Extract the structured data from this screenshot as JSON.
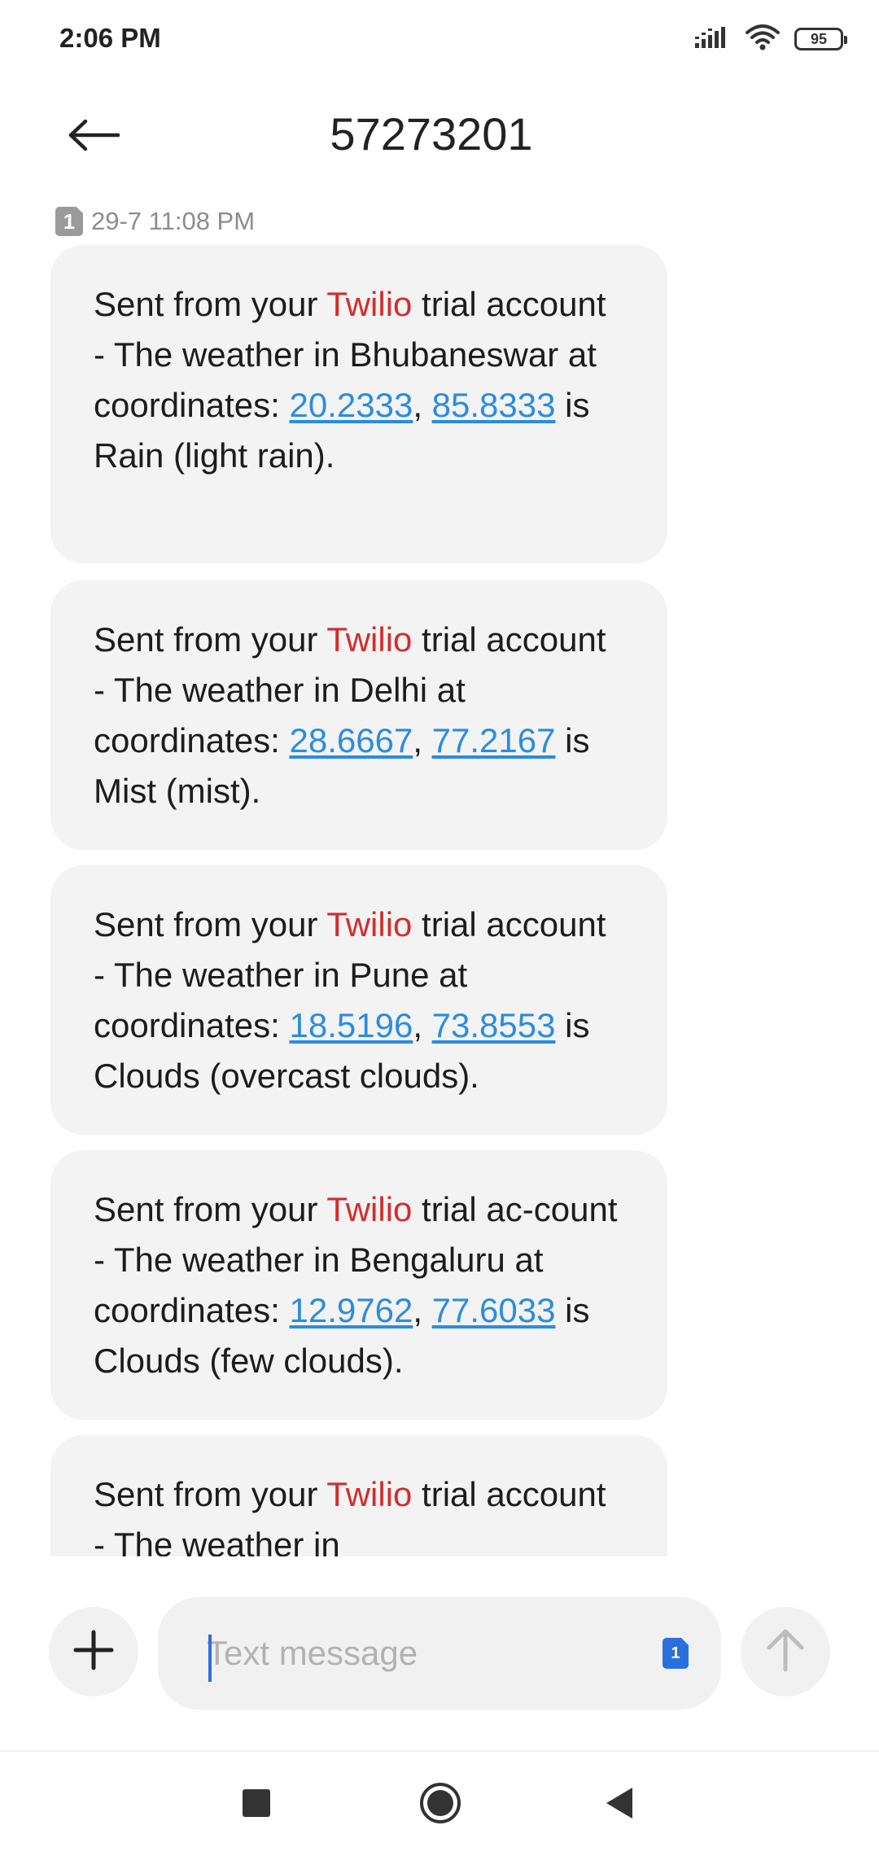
{
  "status_bar": {
    "time": "2:06 PM",
    "battery": "95",
    "icons": [
      "signal-icon",
      "wifi-icon",
      "battery-icon"
    ]
  },
  "header": {
    "title": "57273201",
    "back_icon": "arrow-left-icon"
  },
  "conversation": {
    "sim_badge": "1",
    "timestamp": "29-7 11:08 PM",
    "messages": [
      {
        "pre": "Sent from your ",
        "brand": "Twilio",
        "mid": " trial account - The weather in Bhubaneswar at coordinates: ",
        "lat": "20.2333",
        "sep": ", ",
        "lon": "85.8333",
        "post": " is Rain (light rain)."
      },
      {
        "pre": "Sent from your ",
        "brand": "Twilio",
        "mid": " trial account - The weather in Delhi at coordinates: ",
        "lat": "28.6667",
        "sep": ", ",
        "lon": "77.2167",
        "post": " is Mist (mist)."
      },
      {
        "pre": "Sent from your ",
        "brand": "Twilio",
        "mid": " trial account - The weather in Pune at coordinates: ",
        "lat": "18.5196",
        "sep": ", ",
        "lon": "73.8553",
        "post": " is Clouds (overcast clouds)."
      },
      {
        "pre": "Sent from your ",
        "brand": "Twilio",
        "mid": " trial ac-count - The weather in Bengaluru at coordinates: ",
        "lat": "12.9762",
        "sep": ", ",
        "lon": "77.6033",
        "post": " is Clouds (few clouds)."
      },
      {
        "pre": "Sent from your ",
        "brand": "Twilio",
        "mid": " trial account - The weather in"
      }
    ]
  },
  "compose": {
    "placeholder": "Text message",
    "sim_badge": "1",
    "add_icon": "plus-icon",
    "send_icon": "arrow-up-icon"
  },
  "nav": {
    "icons": [
      "recent-apps-icon",
      "home-icon",
      "back-triangle-icon"
    ]
  },
  "colors": {
    "brand_red": "#d42c2c",
    "link_blue": "#2a8ce0",
    "bubble_bg": "#f3f3f3",
    "accent_blue": "#2b6fde"
  }
}
